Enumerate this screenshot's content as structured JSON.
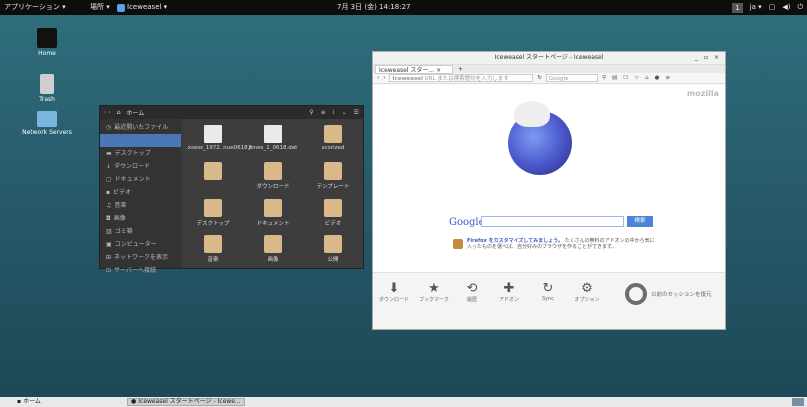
{
  "topbar": {
    "applications": "アプリケーション ▾",
    "places": "場所 ▾",
    "active_window": "Iceweasel ▾",
    "clock": "7月 3日 (金) 14:18:27",
    "workspace": "1",
    "input_method": "ja ▾",
    "icons": [
      "window-icon",
      "volume-icon",
      "power-icon"
    ]
  },
  "desktop": {
    "icons": [
      {
        "label": "Home",
        "glyph": "folder-icon"
      },
      {
        "label": "Trash",
        "glyph": "trash-icon"
      },
      {
        "label": "Network Servers",
        "glyph": "network-icon"
      }
    ]
  },
  "filemanager": {
    "title": "ホーム",
    "sidebar": [
      {
        "label": "最近開いたファイル",
        "selected": false
      },
      {
        "label": "",
        "selected": true
      },
      {
        "label": "デスクトップ",
        "selected": false
      },
      {
        "label": "ダウンロード",
        "selected": false
      },
      {
        "label": "ドキュメント",
        "selected": false
      },
      {
        "label": "ビデオ",
        "selected": false
      },
      {
        "label": "音楽",
        "selected": false
      },
      {
        "label": "画像",
        "selected": false
      },
      {
        "label": "ゴミ箱",
        "selected": false
      },
      {
        "label": "コンピューター",
        "selected": false
      },
      {
        "label": "ネットワークを表示",
        "selected": false
      },
      {
        "label": "サーバーへ接続",
        "selected": false
      }
    ],
    "files": [
      {
        "name": ".xsess_1972..nue0618.f",
        "type": "doc"
      },
      {
        "name": "Jones_1_0618.dat",
        "type": "doc"
      },
      {
        "name": "scorized",
        "type": "folder"
      },
      {
        "name": "",
        "type": "folder"
      },
      {
        "name": "ダウンロード",
        "type": "folder"
      },
      {
        "name": "テンプレート",
        "type": "folder"
      },
      {
        "name": "デスクトップ",
        "type": "folder"
      },
      {
        "name": "ドキュメント",
        "type": "folder"
      },
      {
        "name": "ビデオ",
        "type": "folder"
      },
      {
        "name": "音楽",
        "type": "folder"
      },
      {
        "name": "画像",
        "type": "folder"
      },
      {
        "name": "公開",
        "type": "folder"
      }
    ]
  },
  "browser": {
    "title": "Iceweasel スタートページ - Iceweasel",
    "tab_label": "Iceweasel スター...",
    "url_prefix": "Iceweasel",
    "url_placeholder": "URL または検索語句を入力します",
    "search_engine_placeholder": "Google",
    "brand": "mozilla",
    "google_label": "Google",
    "search_button": "検索",
    "tip_bold": "Firefox をカスタマイズしてみましょう。",
    "tip_rest": "たくさんの無料のアドオンの中から気に入ったものを選べば、自分好みのブラウザを作ることができます。",
    "bottom_items": [
      {
        "label": "ダウンロード",
        "icon": "download-icon",
        "glyph": "⬇"
      },
      {
        "label": "ブックマーク",
        "icon": "star-icon",
        "glyph": "★"
      },
      {
        "label": "履歴",
        "icon": "history-icon",
        "glyph": "⟲"
      },
      {
        "label": "アドオン",
        "icon": "puzzle-icon",
        "glyph": "✚"
      },
      {
        "label": "Sync",
        "icon": "sync-icon",
        "glyph": "↻"
      },
      {
        "label": "オプション",
        "icon": "gear-icon",
        "glyph": "⚙"
      }
    ],
    "restore_label": "以前のセッションを復元"
  },
  "bottombar": {
    "home_task": "ホーム",
    "browser_task": "Iceweasel スタートページ - Icewe..."
  }
}
